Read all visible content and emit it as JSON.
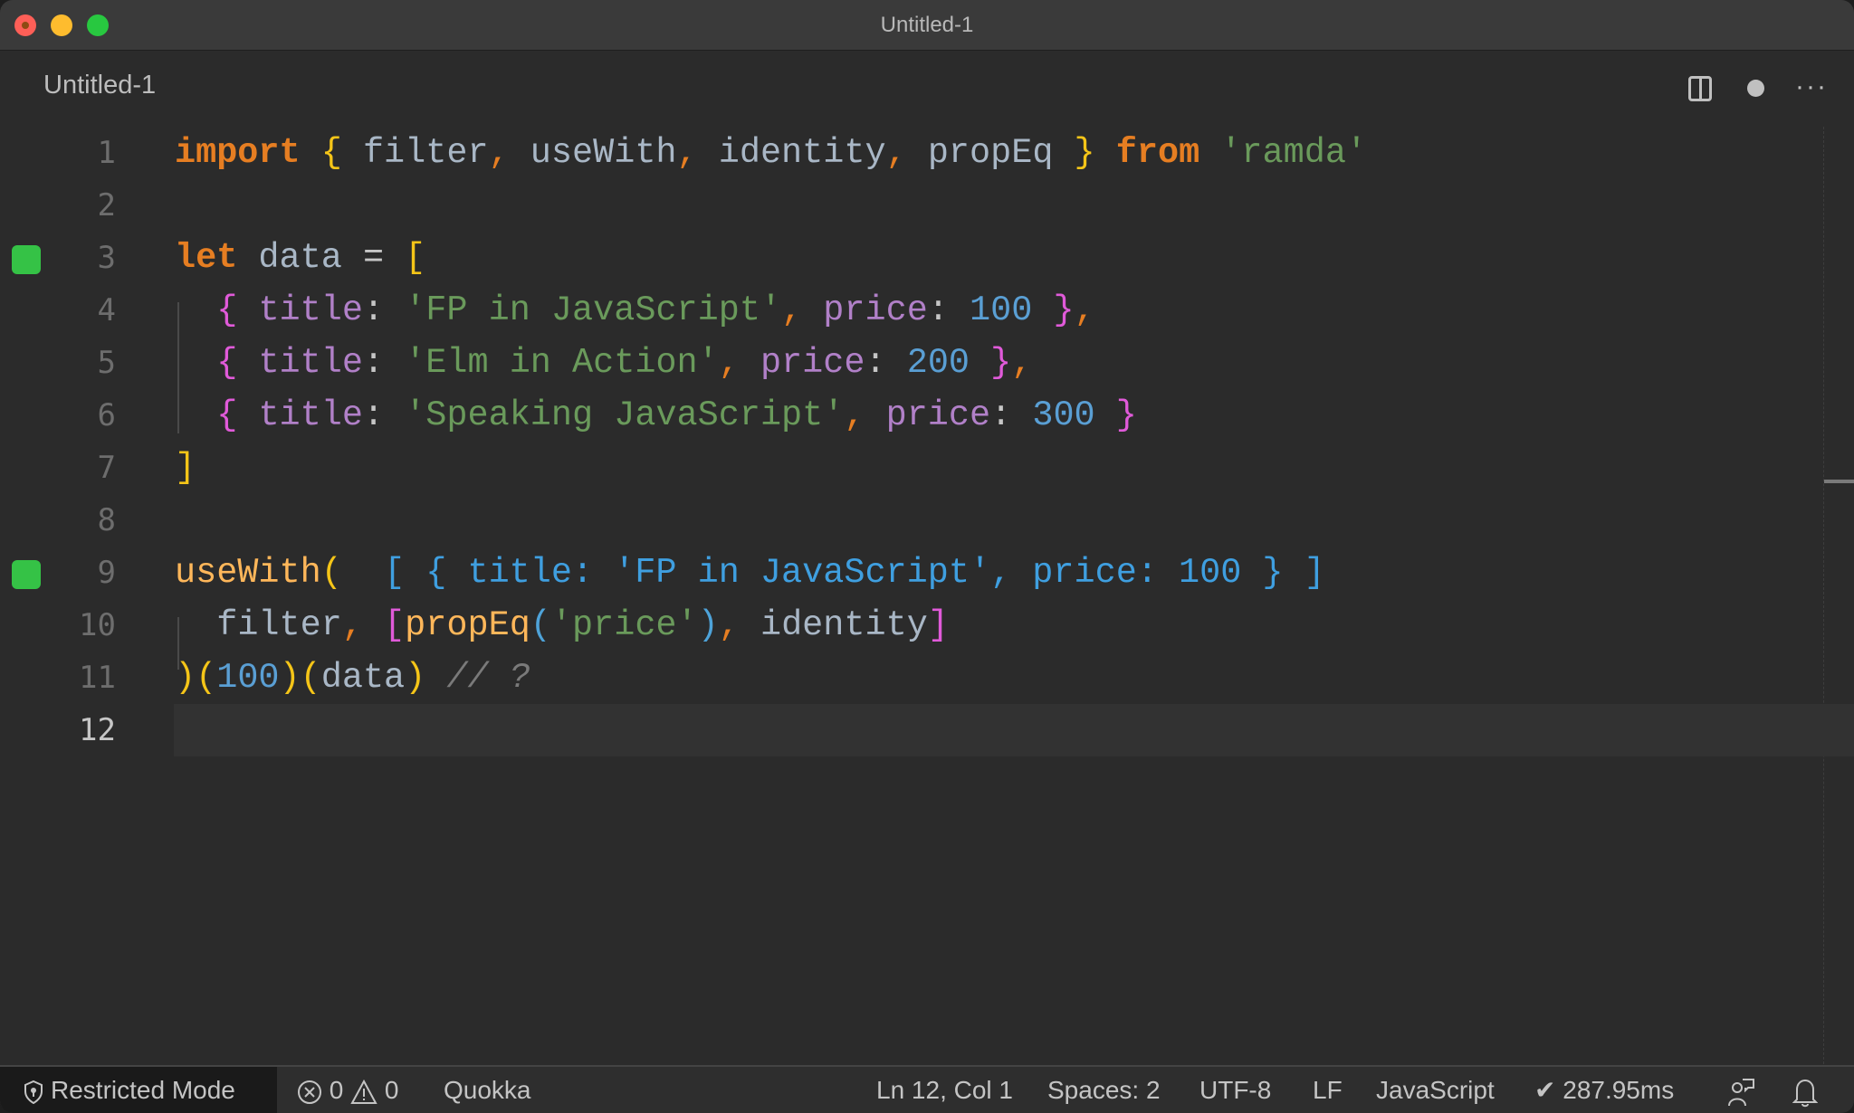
{
  "window": {
    "title": "Untitled-1"
  },
  "tab": {
    "label": "Untitled-1"
  },
  "tab_actions": {
    "split_editor": "split-editor-icon",
    "dirty_indicator": "unsaved-dot-icon",
    "more_actions": "···"
  },
  "editor": {
    "current_line": 12,
    "lines": [
      {
        "number": "1"
      },
      {
        "number": "2"
      },
      {
        "number": "3",
        "marker": "quokka-coverage"
      },
      {
        "number": "4"
      },
      {
        "number": "5"
      },
      {
        "number": "6"
      },
      {
        "number": "7"
      },
      {
        "number": "8"
      },
      {
        "number": "9",
        "marker": "quokka-coverage"
      },
      {
        "number": "10"
      },
      {
        "number": "11"
      },
      {
        "number": "12"
      }
    ],
    "code": {
      "l1": {
        "import": "import",
        "open": "{",
        "id1": "filter",
        "id2": "useWith",
        "id3": "identity",
        "id4": "propEq",
        "close": "}",
        "from": "from",
        "module": "'ramda'"
      },
      "l3": {
        "let": "let",
        "name": "data",
        "eq": "=",
        "open": "["
      },
      "rows": [
        {
          "key1": "title",
          "title": "'FP in JavaScript'",
          "key2": "price",
          "price": "100",
          "trail": ","
        },
        {
          "key1": "title",
          "title": "'Elm in Action'",
          "key2": "price",
          "price": "200",
          "trail": ","
        },
        {
          "key1": "title",
          "title": "'Speaking JavaScript'",
          "key2": "price",
          "price": "300",
          "trail": ""
        }
      ],
      "l7": {
        "close": "]"
      },
      "l9": {
        "fn": "useWith",
        "open": "(",
        "inline_result": "[ { title: 'FP in JavaScript', price: 100 } ]"
      },
      "l10": {
        "id1": "filter",
        "fn": "propEq",
        "arg": "'price'",
        "id2": "identity"
      },
      "l11": {
        "num": "100",
        "arg": "data",
        "comment": "// ?"
      }
    }
  },
  "statusbar": {
    "restricted_mode": "Restricted Mode",
    "errors": "0",
    "warnings": "0",
    "quokka": "Quokka",
    "position": "Ln 12, Col 1",
    "indent": "Spaces: 2",
    "encoding": "UTF-8",
    "eol": "LF",
    "language": "JavaScript",
    "timing": "✔ 287.95ms"
  }
}
